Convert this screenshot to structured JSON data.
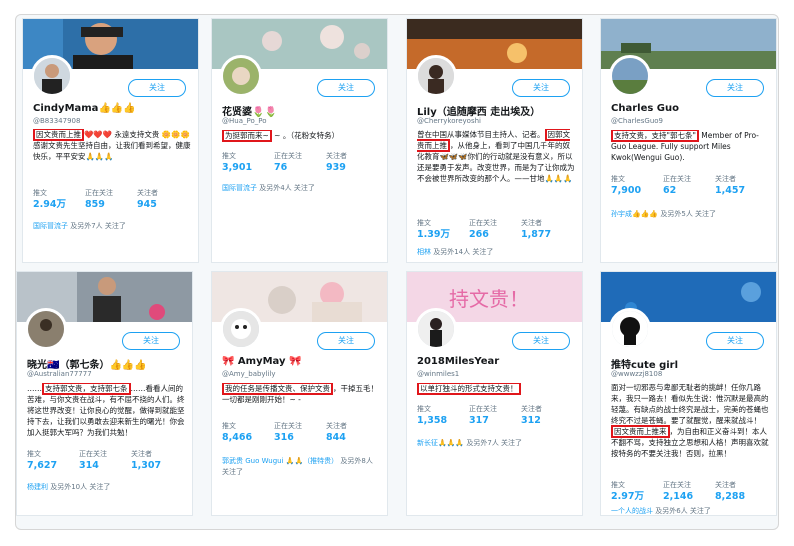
{
  "colors": {
    "accent": "#1da1f2",
    "highlight": "#e0161b"
  },
  "follow_label": "关注",
  "stat_labels": {
    "tweets": "推文",
    "following": "正在关注",
    "followers": "关注者"
  },
  "cards": [
    {
      "name": "CindyMama",
      "name_suffix": "👍👍👍",
      "handle": "@B83347908",
      "bio_highlight": "因文贵而上推",
      "bio_rest": "❤️❤️❤️ 永遠支持文贵 🌼🌼🌼 感谢文贵先生坚持自由，让我们看到希望，健康快乐，平平安安🙏🙏🙏",
      "tweets": "2.94万",
      "following": "859",
      "followers": "945",
      "followed_names": "国际冒流子",
      "followed_rest": " 及另外7人 关注了"
    },
    {
      "name": "花贤婆",
      "name_suffix": "🌷🌷",
      "handle": "@Hua_Po_Po",
      "bio_highlight": "为挺郭而来~",
      "bio_rest": " ~ 。（花粉女特务）",
      "tweets": "3,901",
      "following": "76",
      "followers": "939",
      "followed_names": "国际冒流子",
      "followed_rest": " 及另外4人 关注了"
    },
    {
      "name": "Lily（追随摩西 走出埃及）",
      "handle": "@Cherrykoreyoshi",
      "bio_pre": "曾在中国从事媒体节目主持人、记者。",
      "bio_highlight": "因郭文贵而上推",
      "bio_rest": "，从他身上，看到了中国几千年的奴化教育🦋🦋🦋你们的行动就是没有意义，所以还是要勇于发声。改变世界，而是为了让你成为不会被世界所改变的那个人。——甘地🙏🙏🙏",
      "tweets": "1.39万",
      "following": "266",
      "followers": "1,877",
      "followed_names": "相林",
      "followed_rest": " 及另外14人 关注了"
    },
    {
      "name": "Charles Guo",
      "handle": "@CharlesGuo9",
      "bio_highlight": "支持文贵，支持\"郭七条\"",
      "bio_rest": " Member of Pro-Guo League. Fully support Miles Kwok(Wengui Guo).",
      "tweets": "7,900",
      "following": "62",
      "followers": "1,457",
      "followed_names": "孙宇成👍👍👍",
      "followed_rest": " 及另外5人 关注了"
    },
    {
      "name": "晓光🇦🇺（郭七条）",
      "name_suffix": "👍👍👍",
      "handle": "@Australian77777",
      "bio_pre": "……",
      "bio_highlight": "支持郭文贵，支持郭七条",
      "bio_rest": "……看看人间的苦难，与你文贵在战斗，有不屈不挠的人们。终将这世界改变！让你良心的觉醒，做得到就能坚持下去，让我们以勇敢去迎来新生的曙光！你会加入挺郭大军吗？为我们共勉！",
      "tweets": "7,627",
      "following": "314",
      "followers": "1,307",
      "followed_names": "杨建利",
      "followed_rest": " 及另外10人 关注了"
    },
    {
      "name": "🎀 AmyMay 🎀",
      "handle": "@Amy_babylily",
      "bio_highlight": "我的任务是传播文贵、保护文贵",
      "bio_rest": "，干掉五毛！一切都是刚刚开始！~ -",
      "tweets": "8,466",
      "following": "316",
      "followers": "844",
      "followed_names": "郭武贵 Guo Wugui 🙏🙏（推特贵）",
      "followed_rest": " 及另外8人 关注了"
    },
    {
      "name": "2018MilesYear",
      "handle": "@winmiles1",
      "bio_highlight": "以单打独斗的形式支持文贵！",
      "bio_rest": "",
      "tweets": "1,358",
      "following": "317",
      "followers": "312",
      "followed_names": "新长征🙏🙏🙏",
      "followed_rest": " 及另外7人 关注了"
    },
    {
      "name": "推特cute girl",
      "handle": "@wwwzzj8108",
      "bio_pre": "面对一切邪恶与卑鄙无耻者的挑衅！任你几路来，我只一路去！看似先生说：惟沉默是最高的轻蔑。有缺点的战士终究是战士，完美的苍蝇也终究不过是苍蝇。要了就醒觉，醒来就战斗！",
      "bio_highlight": "因文贵而上推来",
      "bio_rest": "，为自由和正义奋斗到！本人不翻不骂，支持独立之思想和人格！声明喜欢就按特务的不要关注我！否则，拉黑！",
      "tweets": "2.97万",
      "following": "2,146",
      "followers": "8,288",
      "followed_names": "一个人的战斗",
      "followed_rest": " 及另外6人 关注了"
    }
  ]
}
